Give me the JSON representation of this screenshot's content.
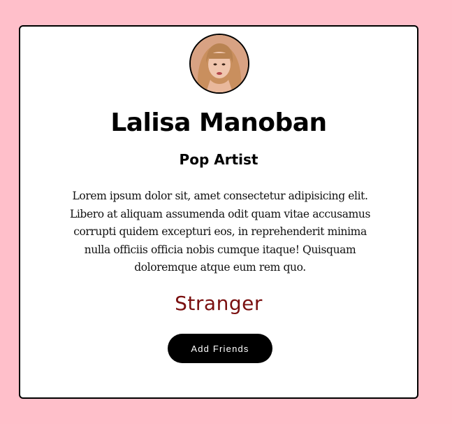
{
  "profile": {
    "name": "Lalisa Manoban",
    "role": "Pop Artist",
    "bio": "Lorem ipsum dolor sit, amet consectetur adipisicing elit. Libero at aliquam assumenda odit quam vitae accusamus corrupti quidem excepturi eos, in reprehenderit minima nulla officiis officia nobis cumque itaque! Quisquam doloremque atque eum rem quo.",
    "status": "Stranger",
    "add_button_label": "Add Friends"
  },
  "colors": {
    "page_background": "#ffbfca",
    "card_background": "#ffffff",
    "status_text": "#7a0f0f",
    "button_background": "#000000",
    "button_text": "#ffffff"
  }
}
